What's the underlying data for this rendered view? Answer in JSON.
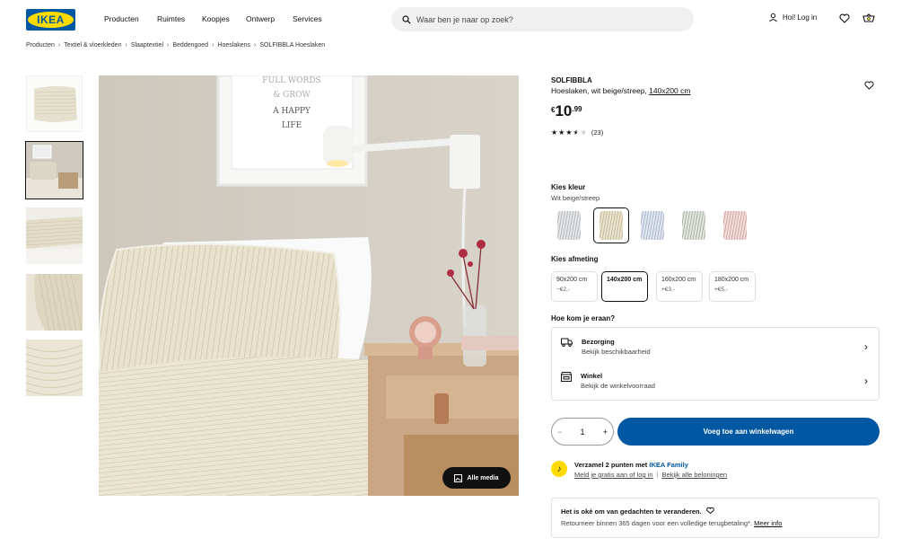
{
  "header": {
    "logo": "IKEA",
    "nav": [
      "Producten",
      "Ruimtes",
      "Koopjes",
      "Ontwerp",
      "Services"
    ],
    "search_placeholder": "Waar ben je naar op zoek?",
    "login": "Hoi! Log in"
  },
  "breadcrumb": [
    "Producten",
    "Textiel & vloerkleden",
    "Slaaptextiel",
    "Beddengoed",
    "Hoeslakens",
    "SOLFIBBLA Hoeslaken"
  ],
  "gallery": {
    "media_button": "Alle media",
    "art_lines": [
      "FULL WORDS",
      "& GROW",
      "A HAPPY",
      "LIFE"
    ]
  },
  "product": {
    "name": "SOLFIBBLA",
    "desc_prefix": "Hoeslaken, wit beige/streep, ",
    "desc_size": "140x200 cm",
    "price_currency": "€",
    "price_int": "10",
    "price_dec": ".99",
    "rating": 3.5,
    "reviews": "(23)"
  },
  "color": {
    "title": "Kies kleur",
    "selected": "Wit beige/streep",
    "swatches": [
      "#d6d8da",
      "#d9cfb6",
      "#c9d2e0",
      "#c7cfc5",
      "#e2c3c0"
    ]
  },
  "size": {
    "title": "Kies afmeting",
    "options": [
      {
        "label": "90x200 cm",
        "price": "−€2,-"
      },
      {
        "label": "140x200 cm",
        "price": ""
      },
      {
        "label": "160x200 cm",
        "price": "+€3,-"
      },
      {
        "label": "180x200 cm",
        "price": "+€5,-"
      }
    ]
  },
  "delivery": {
    "title": "Hoe kom je eraan?",
    "rows": [
      {
        "title": "Bezorging",
        "sub": "Bekijk beschikbaarheid"
      },
      {
        "title": "Winkel",
        "sub": "Bekijk de winkelvoorraad"
      }
    ]
  },
  "cart": {
    "qty": "1",
    "add_label": "Voeg toe aan winkelwagen"
  },
  "family": {
    "title_prefix": "Verzamel 2 punten met ",
    "title_brand": "IKEA Family",
    "sub_a": "Meld je gratis aan of log in",
    "sub_b": "Bekijk alle beloningen"
  },
  "returns": {
    "title": "Het is oké om van gedachten te veranderen.",
    "sub": "Retourneer binnen 365 dagen voor een volledige terugbetaling*.",
    "link": "Meer info"
  },
  "colors": {
    "ikea_blue": "#0058a3",
    "ikea_yellow": "#ffdb00"
  }
}
